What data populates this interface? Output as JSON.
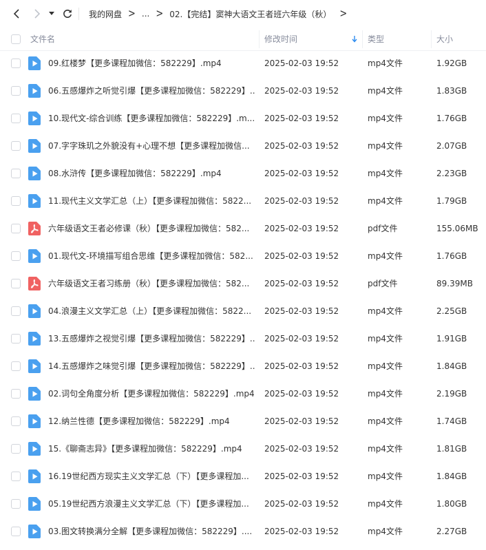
{
  "nav": {
    "breadcrumb": {
      "root": "我的网盘",
      "ellipsis": "...",
      "current": "02.【完结】窦神大语文王者班六年级（秋）"
    }
  },
  "table": {
    "columns": {
      "name": "文件名",
      "modified": "修改时间",
      "type": "类型",
      "size": "大小"
    },
    "rows": [
      {
        "name": "09.红楼梦【更多课程加微信：582229】.mp4",
        "modified": "2025-02-03 19:52",
        "type": "mp4文件",
        "size": "1.92GB",
        "icon": "video-file-icon"
      },
      {
        "name": "06.五感爆炸之听觉引爆【更多课程加微信：582229】....",
        "modified": "2025-02-03 19:52",
        "type": "mp4文件",
        "size": "1.83GB",
        "icon": "video-file-icon"
      },
      {
        "name": "10.现代文-综合训练【更多课程加微信：582229】.m...",
        "modified": "2025-02-03 19:52",
        "type": "mp4文件",
        "size": "1.76GB",
        "icon": "video-file-icon"
      },
      {
        "name": "07.字字珠玑之外貌没有+心理不想【更多课程加微信...",
        "modified": "2025-02-03 19:52",
        "type": "mp4文件",
        "size": "2.07GB",
        "icon": "video-file-icon"
      },
      {
        "name": "08.水浒传【更多课程加微信：582229】.mp4",
        "modified": "2025-02-03 19:52",
        "type": "mp4文件",
        "size": "2.23GB",
        "icon": "video-file-icon"
      },
      {
        "name": "11.现代主义文学汇总（上）【更多课程加微信：5822...",
        "modified": "2025-02-03 19:52",
        "type": "mp4文件",
        "size": "1.79GB",
        "icon": "video-file-icon"
      },
      {
        "name": "六年级语文王者必修课（秋）【更多课程加微信：582...",
        "modified": "2025-02-03 19:52",
        "type": "pdf文件",
        "size": "155.06MB",
        "icon": "pdf-file-icon"
      },
      {
        "name": "01.现代文-环境描写组合思维【更多课程加微信：582...",
        "modified": "2025-02-03 19:52",
        "type": "mp4文件",
        "size": "1.76GB",
        "icon": "video-file-icon"
      },
      {
        "name": "六年级语文王者习练册（秋）【更多课程加微信：582...",
        "modified": "2025-02-03 19:52",
        "type": "pdf文件",
        "size": "89.39MB",
        "icon": "pdf-file-icon"
      },
      {
        "name": "04.浪漫主义文学汇总（上）【更多课程加微信：5822...",
        "modified": "2025-02-03 19:52",
        "type": "mp4文件",
        "size": "2.25GB",
        "icon": "video-file-icon"
      },
      {
        "name": "13.五感爆炸之视觉引爆【更多课程加微信：582229】....",
        "modified": "2025-02-03 19:52",
        "type": "mp4文件",
        "size": "1.91GB",
        "icon": "video-file-icon"
      },
      {
        "name": "14.五感爆炸之味觉引爆【更多课程加微信：582229】....",
        "modified": "2025-02-03 19:52",
        "type": "mp4文件",
        "size": "1.84GB",
        "icon": "video-file-icon"
      },
      {
        "name": "02.词句全角度分析【更多课程加微信：582229】.mp4",
        "modified": "2025-02-03 19:52",
        "type": "mp4文件",
        "size": "2.19GB",
        "icon": "video-file-icon"
      },
      {
        "name": "12.纳兰性德【更多课程加微信：582229】.mp4",
        "modified": "2025-02-03 19:52",
        "type": "mp4文件",
        "size": "1.74GB",
        "icon": "video-file-icon"
      },
      {
        "name": "15.《聊斋志异》【更多课程加微信：582229】.mp4",
        "modified": "2025-02-03 19:52",
        "type": "mp4文件",
        "size": "1.81GB",
        "icon": "video-file-icon"
      },
      {
        "name": "16.19世纪西方现实主义文学汇总（下）【更多课程加...",
        "modified": "2025-02-03 19:52",
        "type": "mp4文件",
        "size": "1.84GB",
        "icon": "video-file-icon"
      },
      {
        "name": "05.19世纪西方浪漫主义文学汇总（下）【更多课程加...",
        "modified": "2025-02-03 19:52",
        "type": "mp4文件",
        "size": "1.80GB",
        "icon": "video-file-icon"
      },
      {
        "name": "03.图文转换满分全解【更多课程加微信：582229】....",
        "modified": "2025-02-03 19:52",
        "type": "mp4文件",
        "size": "2.27GB",
        "icon": "video-file-icon"
      }
    ]
  },
  "colors": {
    "video_icon": "#4aa0ef",
    "pdf_icon": "#f06262",
    "sort_arrow": "#2d8cf0"
  }
}
